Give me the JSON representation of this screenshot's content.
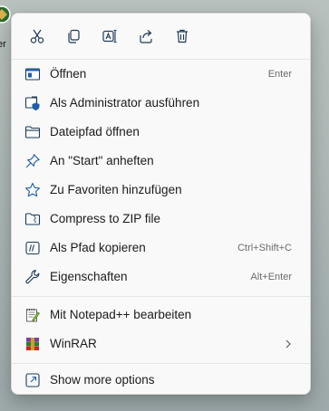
{
  "desktop": {
    "icon": "desktop-app-icon",
    "label_fragment": "er"
  },
  "quick_actions": [
    {
      "name": "cut",
      "icon": "scissors-icon"
    },
    {
      "name": "copy",
      "icon": "copy-icon"
    },
    {
      "name": "rename",
      "icon": "rename-icon"
    },
    {
      "name": "share",
      "icon": "share-icon"
    },
    {
      "name": "delete",
      "icon": "trash-icon"
    }
  ],
  "menu": {
    "items": [
      {
        "label": "Öffnen",
        "shortcut": "Enter",
        "icon": "open-app-icon"
      },
      {
        "label": "Als Administrator ausführen",
        "shortcut": "",
        "icon": "admin-shield-icon"
      },
      {
        "label": "Dateipfad öffnen",
        "shortcut": "",
        "icon": "folder-icon"
      },
      {
        "label": "An \"Start\" anheften",
        "shortcut": "",
        "icon": "pin-icon"
      },
      {
        "label": "Zu Favoriten hinzufügen",
        "shortcut": "",
        "icon": "star-icon"
      },
      {
        "label": "Compress to ZIP file",
        "shortcut": "",
        "icon": "zip-folder-icon"
      },
      {
        "label": "Als Pfad kopieren",
        "shortcut": "Ctrl+Shift+C",
        "icon": "copy-path-icon"
      },
      {
        "label": "Eigenschaften",
        "shortcut": "Alt+Enter",
        "icon": "wrench-icon"
      },
      {
        "label": "Mit Notepad++ bearbeiten",
        "shortcut": "",
        "icon": "notepadpp-icon"
      },
      {
        "label": "WinRAR",
        "shortcut": "",
        "icon": "winrar-icon",
        "submenu": true
      },
      {
        "label": "Show more options",
        "shortcut": "",
        "icon": "show-more-icon"
      }
    ]
  },
  "colors": {
    "accent": "#0067c0",
    "icon_stroke": "#1f3b57",
    "menu_bg": "#f9f9f9",
    "separator": "#e5e5e5",
    "shortcut_text": "#6b6b6b"
  }
}
